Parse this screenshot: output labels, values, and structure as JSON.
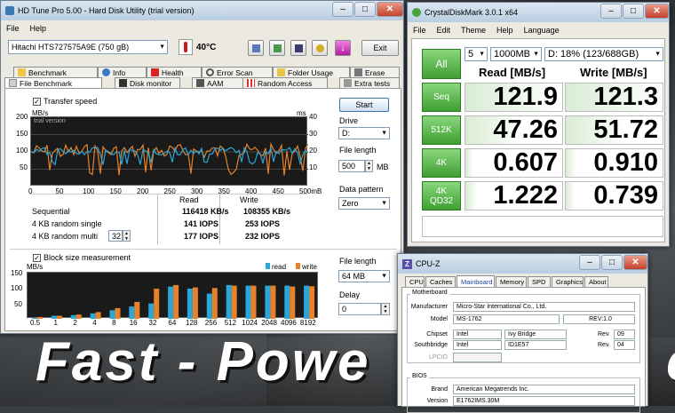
{
  "slogan": "Fast - Powe",
  "slogan_tail": "c",
  "hdtune": {
    "title": "HD Tune Pro 5.00 - Hard Disk Utility (trial version)",
    "menu": [
      "File",
      "Help"
    ],
    "drive": "Hitachi HTS727575A9E    (750 gB)",
    "temperature": "40°C",
    "exit": "Exit",
    "tabs_row1": [
      "Benchmark",
      "Info",
      "Health",
      "Error Scan",
      "Folder Usage",
      "Erase"
    ],
    "tabs_row2": [
      "File Benchmark",
      "Disk monitor",
      "AAM",
      "Random Access",
      "Extra tests"
    ],
    "transfer_speed": "Transfer speed",
    "unit_left": "MB/s",
    "unit_right": "ms",
    "watermark": "trial version",
    "y_left": [
      "200",
      "150",
      "100",
      "50"
    ],
    "y_right": [
      "40",
      "30",
      "20",
      "10"
    ],
    "x_ticks": [
      "0",
      "50",
      "100",
      "150",
      "200",
      "250",
      "300",
      "350",
      "400",
      "450",
      "500mB"
    ],
    "start": "Start",
    "drive_label": "Drive",
    "drive_value": "D:",
    "file_length_label": "File length",
    "file_length_value": "500",
    "file_length_unit": "MB",
    "data_pattern_label": "Data pattern",
    "data_pattern_value": "Zero",
    "col_read": "Read",
    "col_write": "Write",
    "rows": [
      {
        "label": "Sequential",
        "read": "116418 KB/s",
        "write": "108355 KB/s"
      },
      {
        "label": "4 KB random single",
        "read": "141 IOPS",
        "write": "253 IOPS"
      },
      {
        "label": "4 KB random multi",
        "read": "177 IOPS",
        "write": "232 IOPS"
      }
    ],
    "multi_value": "32",
    "block_size": "Block size measurement",
    "block_unit": "MB/s",
    "legend_read": "read",
    "legend_write": "write",
    "block_y": [
      "150",
      "100",
      "50"
    ],
    "file_length2_label": "File length",
    "file_length2_value": "64 MB",
    "delay_label": "Delay",
    "delay_value": "0",
    "colors": {
      "read": "#2aa7d8",
      "write": "#e8822a"
    }
  },
  "block_chart": {
    "type": "bar",
    "categories": [
      "0.5",
      "1",
      "2",
      "4",
      "8",
      "16",
      "32",
      "64",
      "128",
      "256",
      "512",
      "1024",
      "2048",
      "4096",
      "8192"
    ],
    "series": [
      {
        "name": "read",
        "values": [
          3,
          10,
          12,
          18,
          28,
          40,
          50,
          105,
          98,
          82,
          110,
          108,
          108,
          108,
          108
        ]
      },
      {
        "name": "write",
        "values": [
          6,
          10,
          14,
          22,
          35,
          55,
          98,
          110,
          102,
          100,
          108,
          108,
          108,
          105,
          106
        ]
      }
    ],
    "ylim": [
      0,
      150
    ]
  },
  "cdm": {
    "title": "CrystalDiskMark 3.0.1 x64",
    "menu": [
      "File",
      "Edit",
      "Theme",
      "Help",
      "Language"
    ],
    "all": "All",
    "runs": "5",
    "size": "1000MB",
    "drive": "D: 18% (123/688GB)",
    "read_header": "Read [MB/s]",
    "write_header": "Write [MB/s]",
    "rows": [
      {
        "label": "Seq",
        "read": "121.9",
        "write": "121.3"
      },
      {
        "label": "512K",
        "read": "47.26",
        "write": "51.72"
      },
      {
        "label": "4K",
        "read": "0.607",
        "write": "0.910"
      },
      {
        "label": "4K QD32",
        "read": "1.222",
        "write": "0.739"
      }
    ]
  },
  "cpuz": {
    "title": "CPU-Z",
    "tabs": [
      "CPU",
      "Caches",
      "Mainboard",
      "Memory",
      "SPD",
      "Graphics",
      "About"
    ],
    "motherboard_label": "Motherboard",
    "manufacturer_label": "Manufacturer",
    "manufacturer": "Micro-Star International Co., Ltd.",
    "model_label": "Model",
    "model": "MS-1762",
    "rev_model": "REV:1.0",
    "chipset_label": "Chipset",
    "chipset_vendor": "Intel",
    "chipset_name": "Ivy Bridge",
    "rev_label": "Rev.",
    "chipset_rev": "09",
    "southbridge_label": "Southbridge",
    "sb_vendor": "Intel",
    "sb_name": "ID1E57",
    "sb_rev": "04",
    "lpcio_label": "LPCIO",
    "bios_label": "BIOS",
    "brand_label": "Brand",
    "brand": "American Megatrends Inc.",
    "version_label": "Version",
    "version": "E1762IMS.30M"
  }
}
